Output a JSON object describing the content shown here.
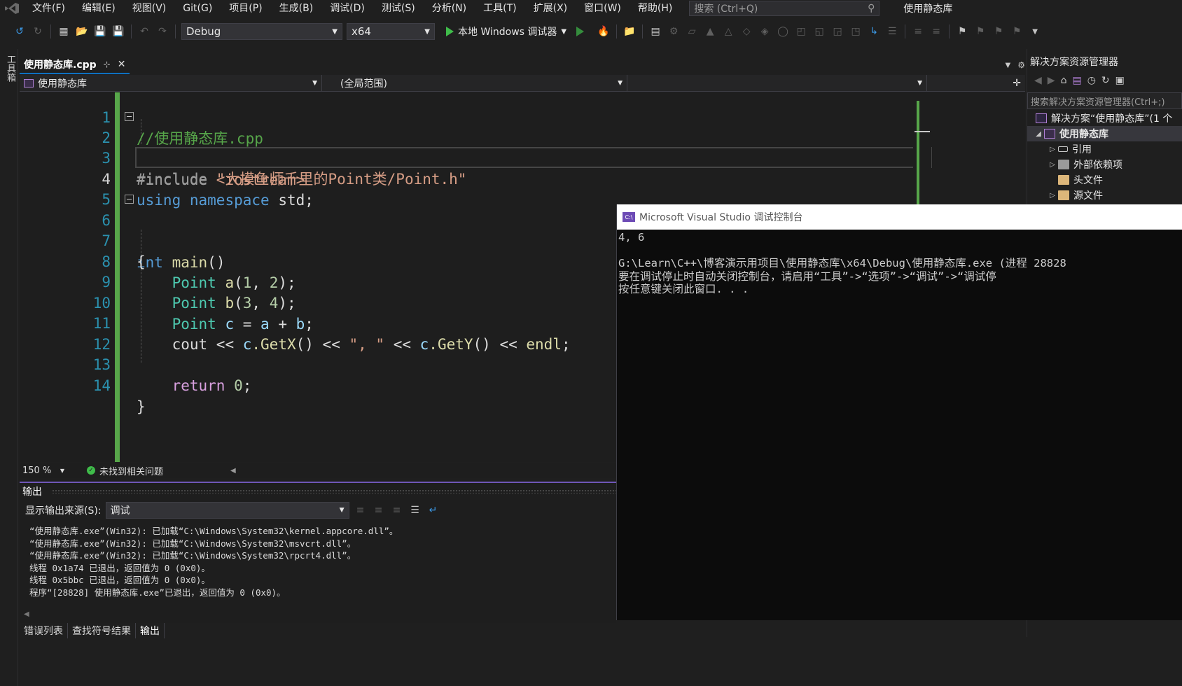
{
  "menubar": {
    "items": [
      "文件(F)",
      "编辑(E)",
      "视图(V)",
      "Git(G)",
      "项目(P)",
      "生成(B)",
      "调试(D)",
      "测试(S)",
      "分析(N)",
      "工具(T)",
      "扩展(X)",
      "窗口(W)",
      "帮助(H)"
    ],
    "search_placeholder": "搜索 (Ctrl+Q)",
    "solution_title": "使用静态库"
  },
  "toolbar": {
    "configuration": "Debug",
    "platform": "x64",
    "run_label": "本地 Windows 调试器"
  },
  "left_strip": {
    "toolbox_label": "工具箱"
  },
  "editor": {
    "tab_name": "使用静态库.cpp",
    "nav_project": "使用静态库",
    "nav_scope": "(全局范围)",
    "zoom": "150 %",
    "issues_status": "未找到相关问题",
    "line_numbers": [
      "1",
      "2",
      "3",
      "4",
      "5",
      "6",
      "7",
      "8",
      "9",
      "10",
      "11",
      "12",
      "13",
      "14"
    ],
    "lines": [
      {
        "comment": "//使用静态库.cpp"
      },
      {
        "pp": "#include ",
        "str": "<iostream>"
      },
      {
        "pp": "#include ",
        "str": "\"大摸鱼师千里的Point类/Point.h\""
      },
      {
        "kw1": "using",
        "kw2": "namespace",
        "id": "std",
        "end": ";"
      },
      {},
      {
        "kw1": "int",
        "fn": "main",
        "end": "()"
      },
      {
        "plain": "{"
      },
      {
        "type": "Point",
        "var": "a",
        "args_open": "(",
        "n1": "1",
        "sep": ", ",
        "n2": "2",
        "args_close": ");"
      },
      {
        "type": "Point",
        "var": "b",
        "args_open": "(",
        "n1": "3",
        "sep": ", ",
        "n2": "4",
        "args_close": ");"
      },
      {
        "type": "Point",
        "var": "c",
        "eq": " = ",
        "v1": "a",
        "op": " + ",
        "v2": "b",
        "end": ";"
      },
      {
        "cout": "cout",
        "op1": " << ",
        "obj1": "c",
        "m1": ".GetX",
        "p1": "()",
        "op2": " << ",
        "s": "\", \"",
        "op3": " << ",
        "obj2": "c",
        "m2": ".GetY",
        "p2": "()",
        "op4": " << ",
        "endl": "endl",
        "end": ";"
      },
      {},
      {
        "kw": "return",
        "num": "0",
        "end": ";"
      },
      {
        "plain": "}"
      }
    ]
  },
  "output": {
    "title": "输出",
    "source_label": "显示输出来源(S):",
    "source_value": "调试",
    "lines": [
      "“使用静态库.exe”(Win32): 已加载“C:\\Windows\\System32\\kernel.appcore.dll”。",
      "“使用静态库.exe”(Win32): 已加载“C:\\Windows\\System32\\msvcrt.dll”。",
      "“使用静态库.exe”(Win32): 已加载“C:\\Windows\\System32\\rpcrt4.dll”。",
      "线程 0x1a74 已退出，返回值为 0 (0x0)。",
      "线程 0x5bbc 已退出，返回值为 0 (0x0)。",
      "程序“[28828] 使用静态库.exe”已退出，返回值为 0 (0x0)。"
    ]
  },
  "bottom_tabs": [
    "错误列表",
    "查找符号结果",
    "输出"
  ],
  "solution_explorer": {
    "title": "解决方案资源管理器",
    "search_placeholder": "搜索解决方案资源管理器(Ctrl+;)",
    "solution_node": "解决方案“使用静态库”(1 个",
    "project_node": "使用静态库",
    "children": [
      "引用",
      "外部依赖项",
      "头文件",
      "源文件"
    ]
  },
  "console": {
    "title": "Microsoft Visual Studio 调试控制台",
    "icon_text": "C:\\",
    "lines": [
      "4, 6",
      "",
      "G:\\Learn\\C++\\博客演示用项目\\使用静态库\\x64\\Debug\\使用静态库.exe (进程 28828",
      "要在调试停止时自动关闭控制台，请启用“工具”->“选项”->“调试”->“调试停",
      "按任意键关闭此窗口. . ."
    ]
  }
}
